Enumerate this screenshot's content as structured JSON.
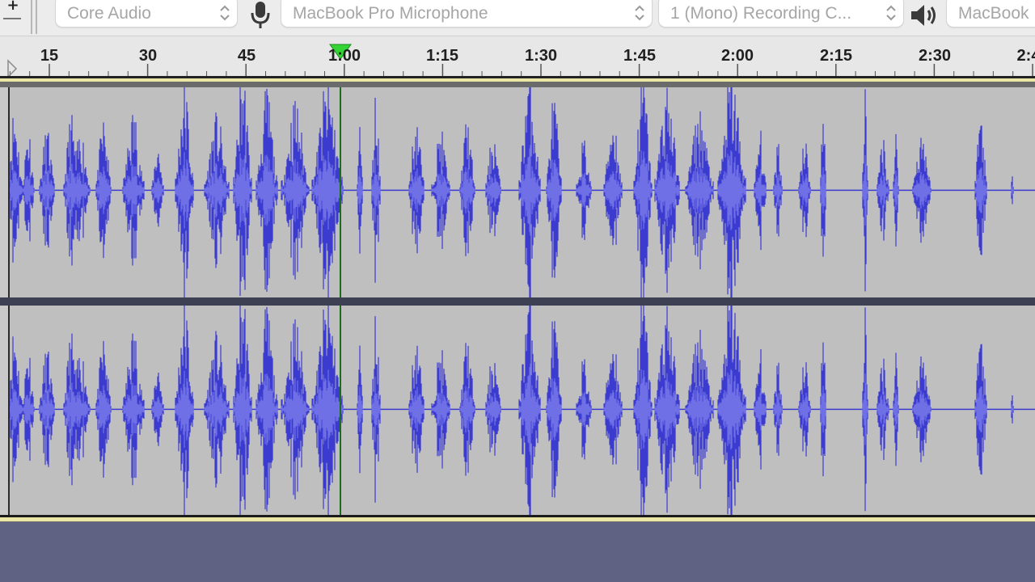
{
  "toolbar": {
    "host": {
      "value": "Core Audio"
    },
    "recording_device": {
      "value": "MacBook Pro Microphone"
    },
    "recording_channels": {
      "value": "1 (Mono) Recording C..."
    },
    "playback_device": {
      "value": "MacBook"
    },
    "icons": [
      "plus-icon",
      "microphone-icon",
      "speaker-icon"
    ]
  },
  "ruler": {
    "labels": [
      "15",
      "30",
      "45",
      "1:00",
      "1:15",
      "1:30",
      "1:45",
      "2:00",
      "2:15",
      "2:30",
      "2:4"
    ],
    "playhead_label": "1:00"
  },
  "track": {
    "channels": [
      "left",
      "right"
    ],
    "waveform_color": "#3b3bd0",
    "rms_color": "#6f70e6",
    "background_color": "#bfbfbf",
    "playhead_color": "#1d6b1d"
  }
}
